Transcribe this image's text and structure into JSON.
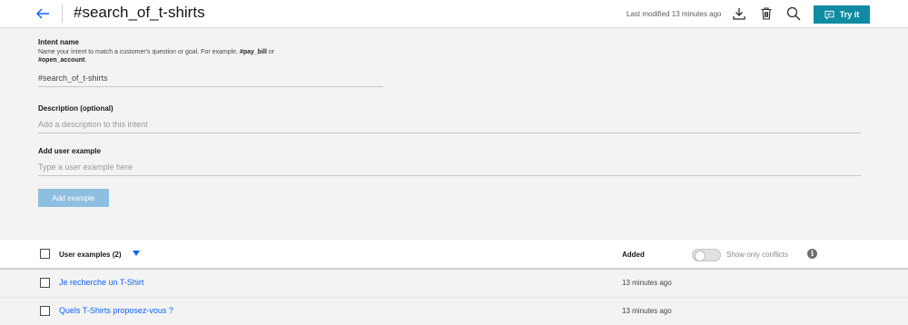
{
  "header": {
    "title": "#search_of_t-shirts",
    "last_modified": "Last modified 13 minutes ago",
    "try_it_label": "Try it",
    "icons": [
      "back-arrow-icon",
      "download-icon",
      "trash-icon",
      "search-icon",
      "chat-icon"
    ],
    "accent_color": "#0f8ba3"
  },
  "form": {
    "intent_name_label": "Intent name",
    "intent_help_prefix": "Name your intent to match a customer's question or goal. For example, ",
    "intent_help_example1": "#pay_bill",
    "intent_help_or": " or ",
    "intent_help_example2": "#open_account",
    "intent_help_suffix": ".",
    "intent_name_value": "#search_of_t-shirts",
    "description_label": "Description (optional)",
    "description_placeholder": "Add a description to this intent",
    "user_example_label": "Add user example",
    "user_example_placeholder": "Type a user example here",
    "add_example_label": "Add example"
  },
  "table": {
    "examples_header": "User examples (2)",
    "added_header": "Added",
    "conflicts_toggle_label": "Show only conflicts",
    "conflicts_toggle_on": false,
    "info_glyph": "i",
    "rows": [
      {
        "text": "Je recherche un T-Shirt",
        "added": "13 minutes ago"
      },
      {
        "text": "Quels T-Shirts proposez-vous ?",
        "added": "13 minutes ago"
      }
    ]
  }
}
